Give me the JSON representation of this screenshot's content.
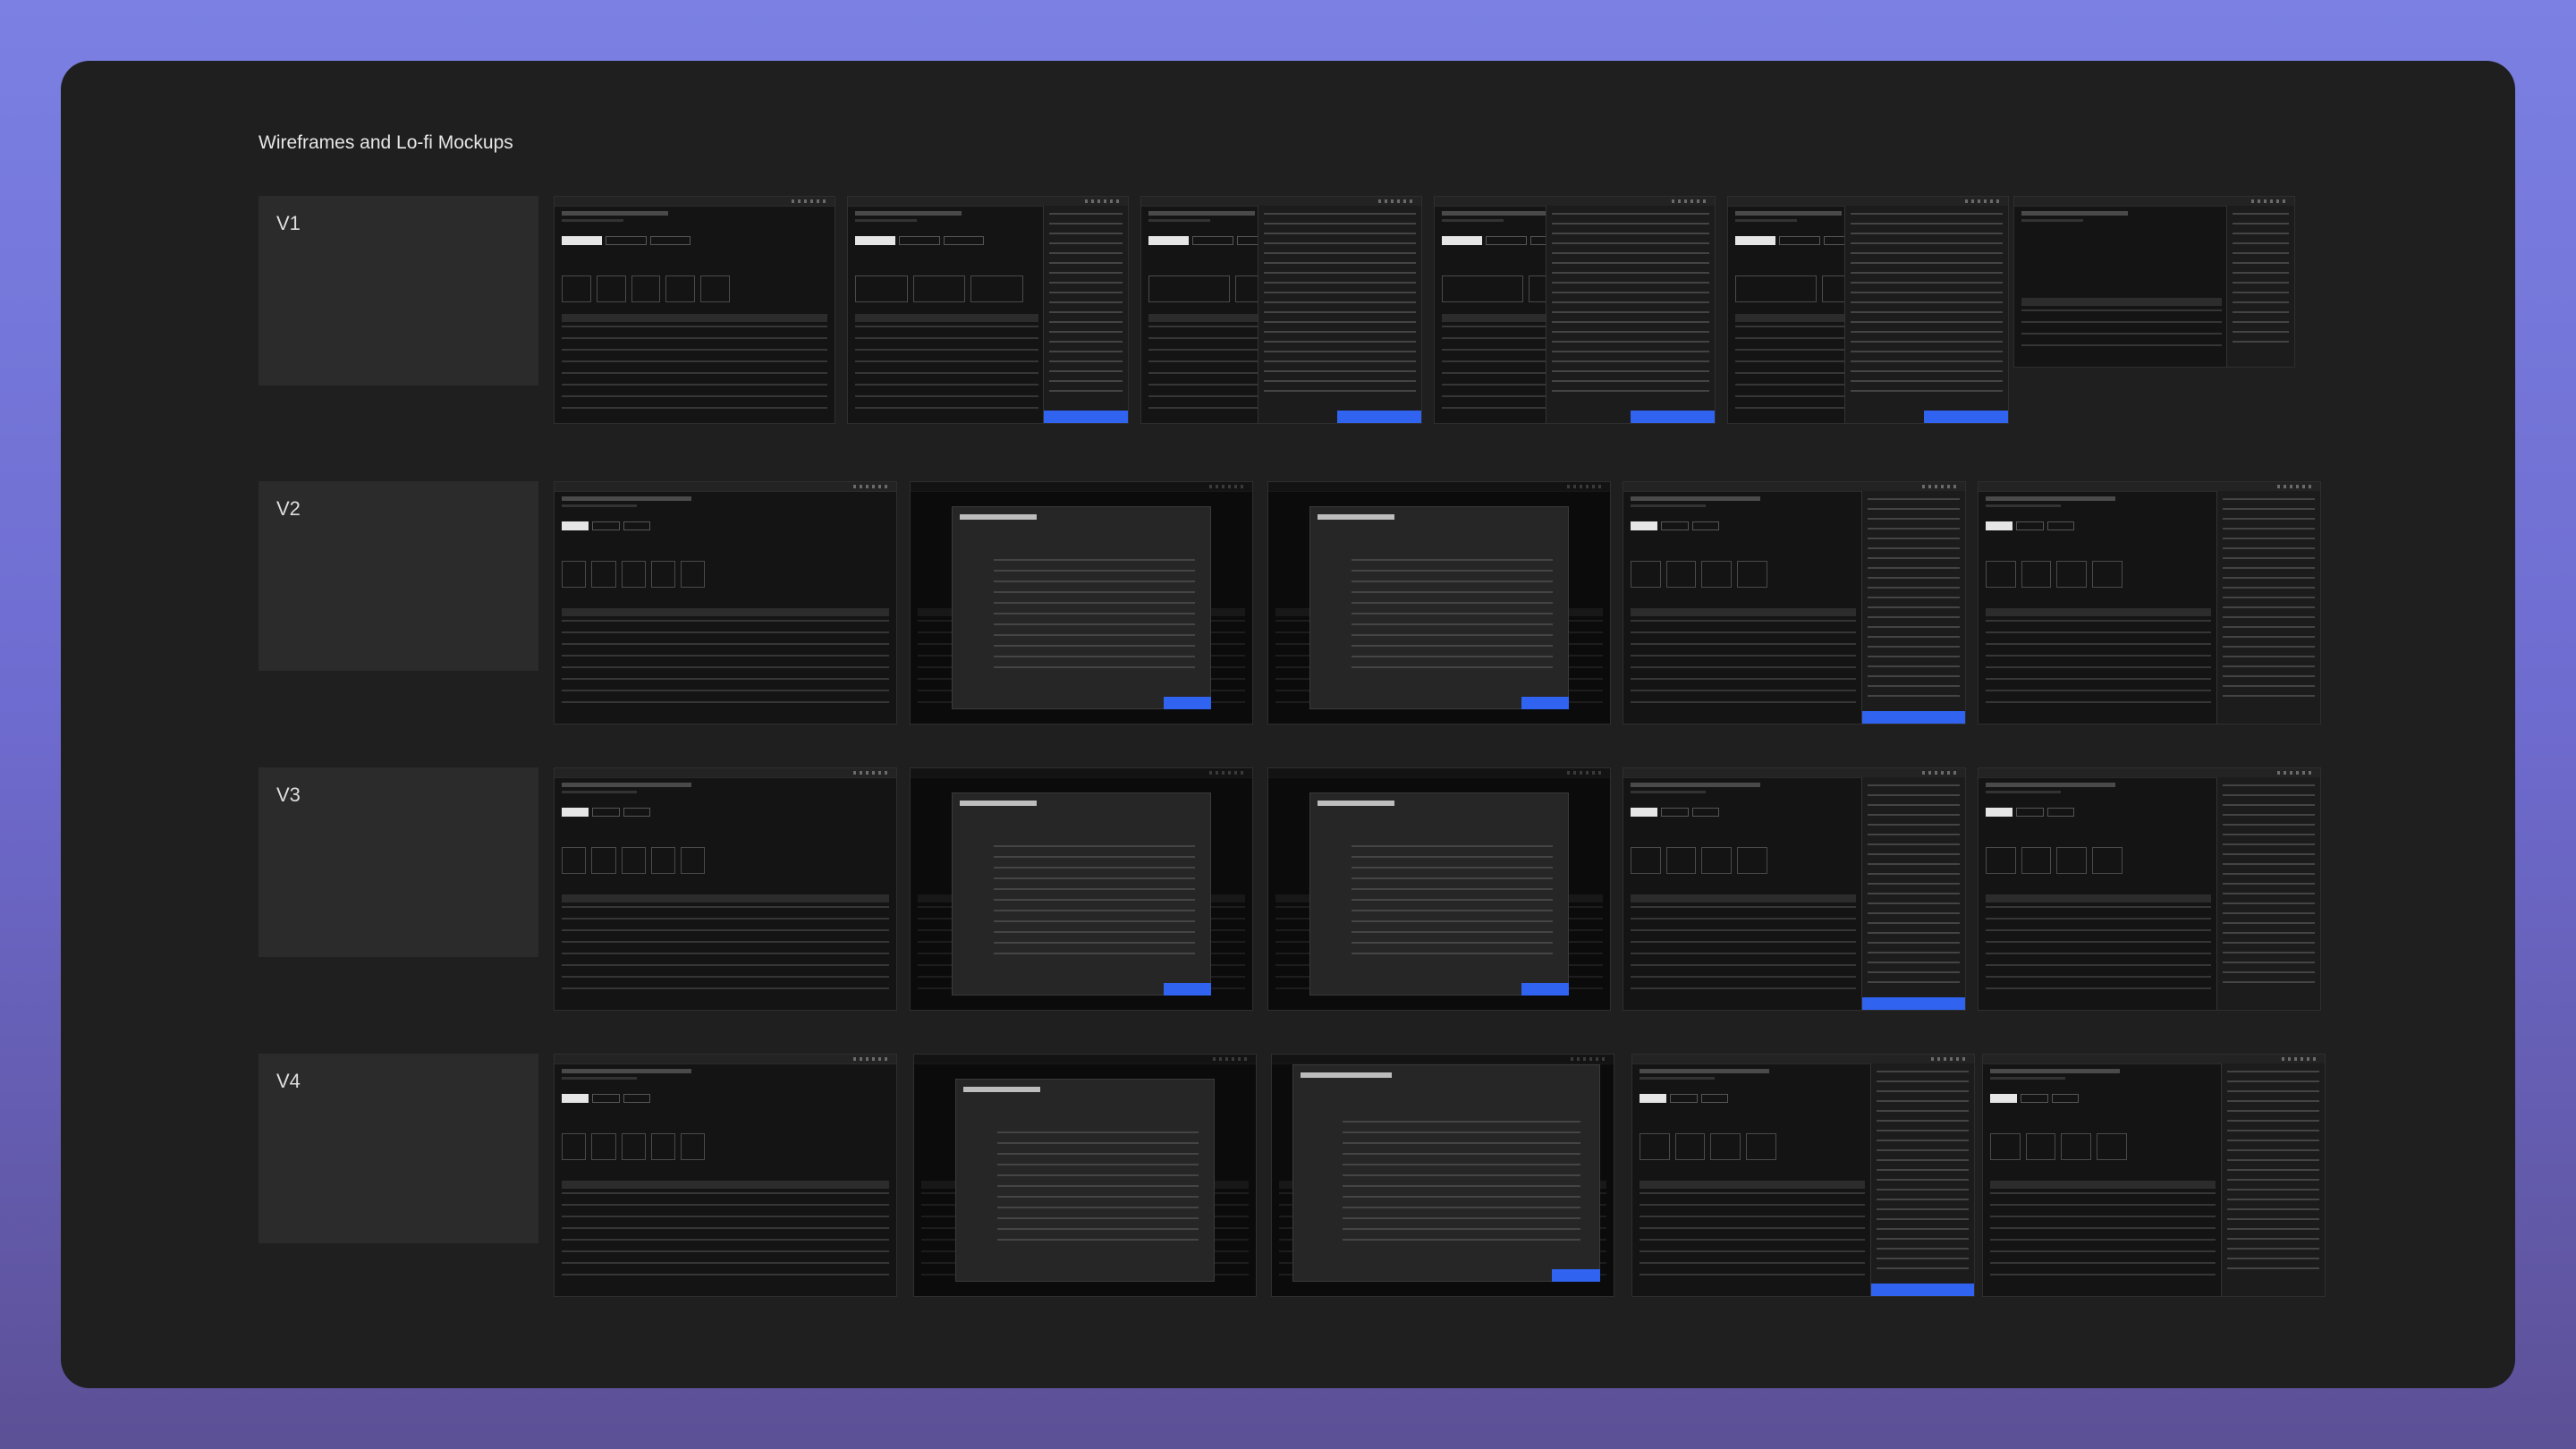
{
  "page_title": "Wireframes and Lo-fi Mockups",
  "rows": [
    {
      "label": "V1",
      "thumb_count": 6
    },
    {
      "label": "V2",
      "thumb_count": 5
    },
    {
      "label": "V3",
      "thumb_count": 5
    },
    {
      "label": "V4",
      "thumb_count": 5
    }
  ],
  "colors": {
    "background_gradient_top": "#7b80e2",
    "background_gradient_bottom": "#5c5096",
    "panel": "#1f1f1f",
    "label_box": "#2b2b2b",
    "accent_blue": "#2f63f0"
  }
}
